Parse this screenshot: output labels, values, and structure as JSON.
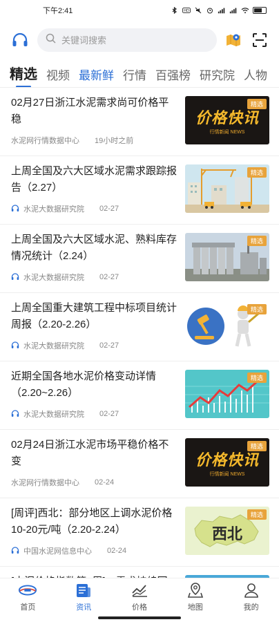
{
  "status_bar": {
    "time": "下午2:41",
    "battery": "62"
  },
  "search": {
    "placeholder": "关键词搜索"
  },
  "tabs": [
    {
      "label": "精选",
      "state": "active"
    },
    {
      "label": "视频",
      "state": "normal"
    },
    {
      "label": "最新鲜",
      "state": "highlight"
    },
    {
      "label": "行情",
      "state": "normal"
    },
    {
      "label": "百强榜",
      "state": "normal"
    },
    {
      "label": "研究院",
      "state": "normal"
    },
    {
      "label": "人物",
      "state": "normal"
    }
  ],
  "badge_label": "精选",
  "price_banner": {
    "text": "价格快讯",
    "sub": "行情新闻 NEWS"
  },
  "news": [
    {
      "title": "02月27日浙江水泥需求尚可价格平稳",
      "source": "水泥网行情数据中心",
      "time": "19小时之前",
      "thumb": "price",
      "show_source_icon": false
    },
    {
      "title": "上周全国及六大区域水泥需求跟踪报告（2.27）",
      "source": "水泥大数据研究院",
      "time": "02-27",
      "thumb": "construction",
      "show_source_icon": true
    },
    {
      "title": "上周全国及六大区域水泥、熟料库存情况统计（2.24）",
      "source": "水泥大数据研究院",
      "time": "02-27",
      "thumb": "silo",
      "show_source_icon": true
    },
    {
      "title": "上周全国重大建筑工程中标项目统计周报（2.20-2.26）",
      "source": "水泥大数据研究院",
      "time": "02-27",
      "thumb": "gavel",
      "show_source_icon": true
    },
    {
      "title": "近期全国各地水泥价格变动详情（2.20~2.26）",
      "source": "水泥大数据研究院",
      "time": "02-27",
      "thumb": "chart",
      "show_source_icon": true
    },
    {
      "title": "02月24日浙江水泥市场平稳价格不变",
      "source": "水泥网行情数据中心",
      "time": "02-24",
      "thumb": "price",
      "show_source_icon": false
    },
    {
      "title": "[周评]西北：部分地区上调水泥价格10-20元/吨（2.20-2.24）",
      "source": "中国水泥网信息中心",
      "time": "02-24",
      "thumb": "map",
      "show_source_icon": true,
      "thumb_text": "西北"
    },
    {
      "title": "[水泥价格指数第6周]：需求持续回",
      "source": "",
      "time": "",
      "thumb": "partial",
      "show_source_icon": false
    }
  ],
  "bottom_nav": [
    {
      "label": "首页",
      "icon": "home-logo-icon",
      "active": false
    },
    {
      "label": "资讯",
      "icon": "news-icon",
      "active": true
    },
    {
      "label": "价格",
      "icon": "price-chart-icon",
      "active": false
    },
    {
      "label": "地图",
      "icon": "map-pin-icon",
      "active": false
    },
    {
      "label": "我的",
      "icon": "user-icon",
      "active": false
    }
  ],
  "colors": {
    "accent": "#2b6fd6",
    "badge": "#e8a33b",
    "price_gold": "#f5b92c"
  }
}
